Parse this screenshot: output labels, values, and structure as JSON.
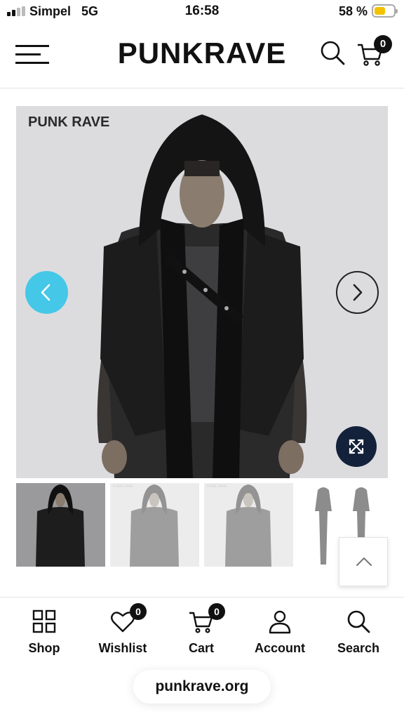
{
  "status_bar": {
    "carrier": "Simpel",
    "network": "5G",
    "time": "16:58",
    "battery_text": "58 %",
    "battery_level": 0.58,
    "battery_color": "#f3c200"
  },
  "header": {
    "logo": "PUNKRAVE",
    "menu_icon": "hamburger-icon",
    "search_icon": "search-icon",
    "cart_icon": "cart-icon",
    "cart_count": "0"
  },
  "product_image": {
    "brand_watermark": "PUNK RAVE",
    "prev_icon": "chevron-left-icon",
    "next_icon": "chevron-right-icon",
    "zoom_icon": "expand-icon",
    "accent_color": "#45c7e7"
  },
  "thumbnails": {
    "brand_watermark": "PUNK RAVE",
    "back_to_top_icon": "chevron-up-icon"
  },
  "bottom_nav": {
    "items": [
      {
        "label": "Shop",
        "icon": "grid-icon"
      },
      {
        "label": "Wishlist",
        "icon": "heart-icon",
        "badge": "0"
      },
      {
        "label": "Cart",
        "icon": "cart-icon",
        "badge": "0"
      },
      {
        "label": "Account",
        "icon": "user-icon"
      },
      {
        "label": "Search",
        "icon": "search-icon"
      }
    ]
  },
  "browser": {
    "url": "punkrave.org"
  }
}
